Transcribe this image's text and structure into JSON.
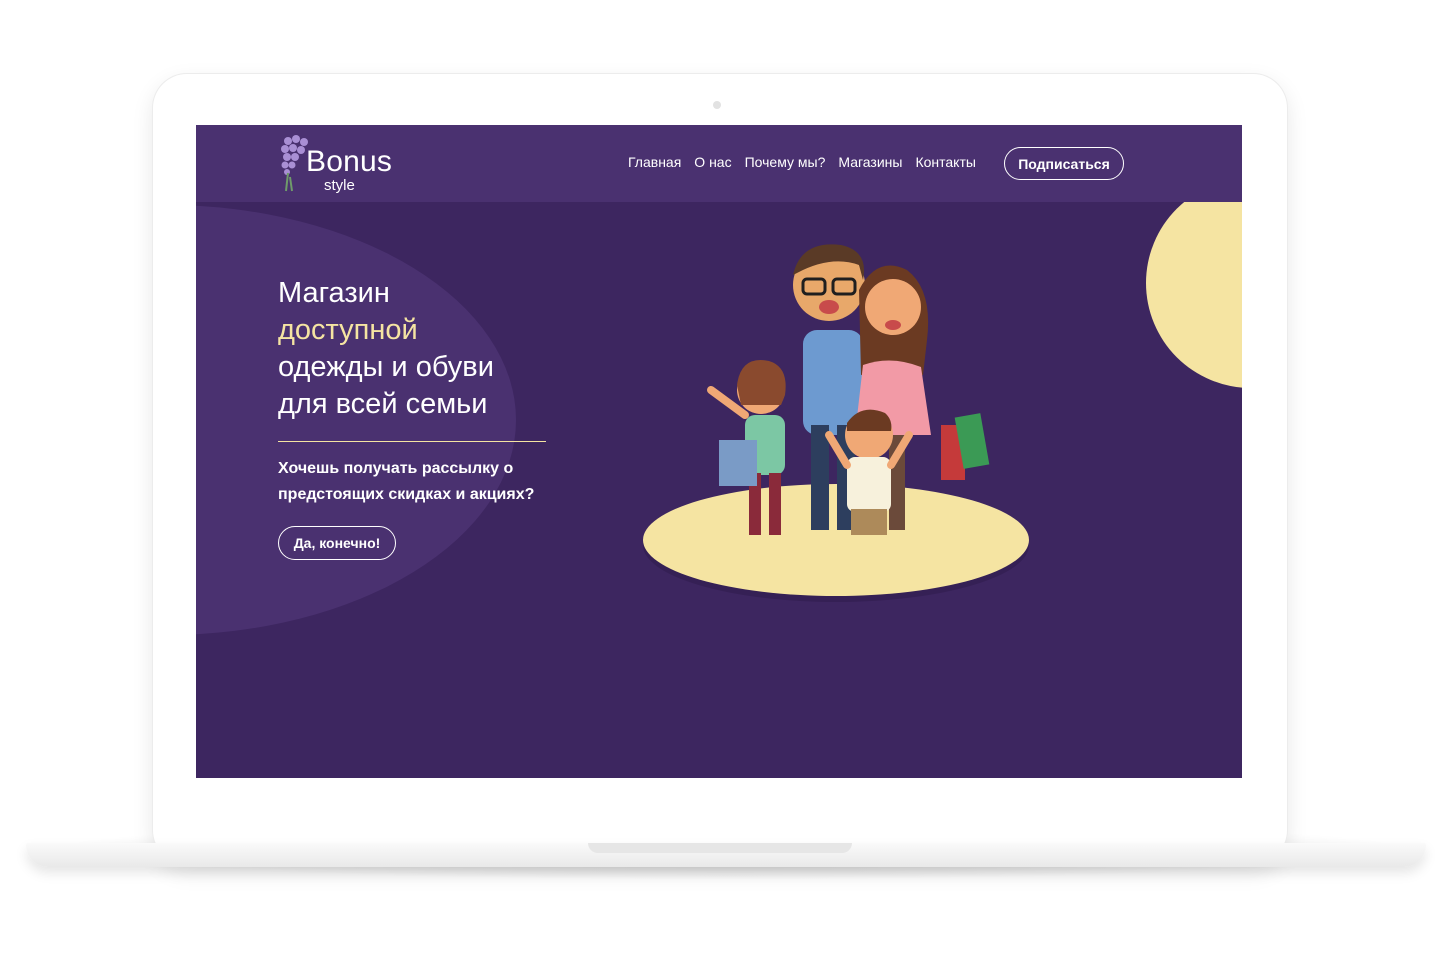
{
  "header": {
    "logo_title": "Bonus",
    "logo_subtitle": "style",
    "nav": [
      "Главная",
      "О нас",
      "Почему мы?",
      "Магазины",
      "Контакты"
    ],
    "subscribe_label": "Подписаться"
  },
  "hero": {
    "headline_line1": "Магазин",
    "headline_accent": "доступной",
    "headline_line3": "одежды и обуви",
    "headline_line4": "для всей семьи",
    "subtext": "Хочешь получать рассылку о предстоящих скидках и акциях?",
    "cta_label": "Да, конечно!"
  },
  "colors": {
    "background": "#3d2660",
    "header": "#4a3170",
    "accent": "#f5e4a2"
  }
}
